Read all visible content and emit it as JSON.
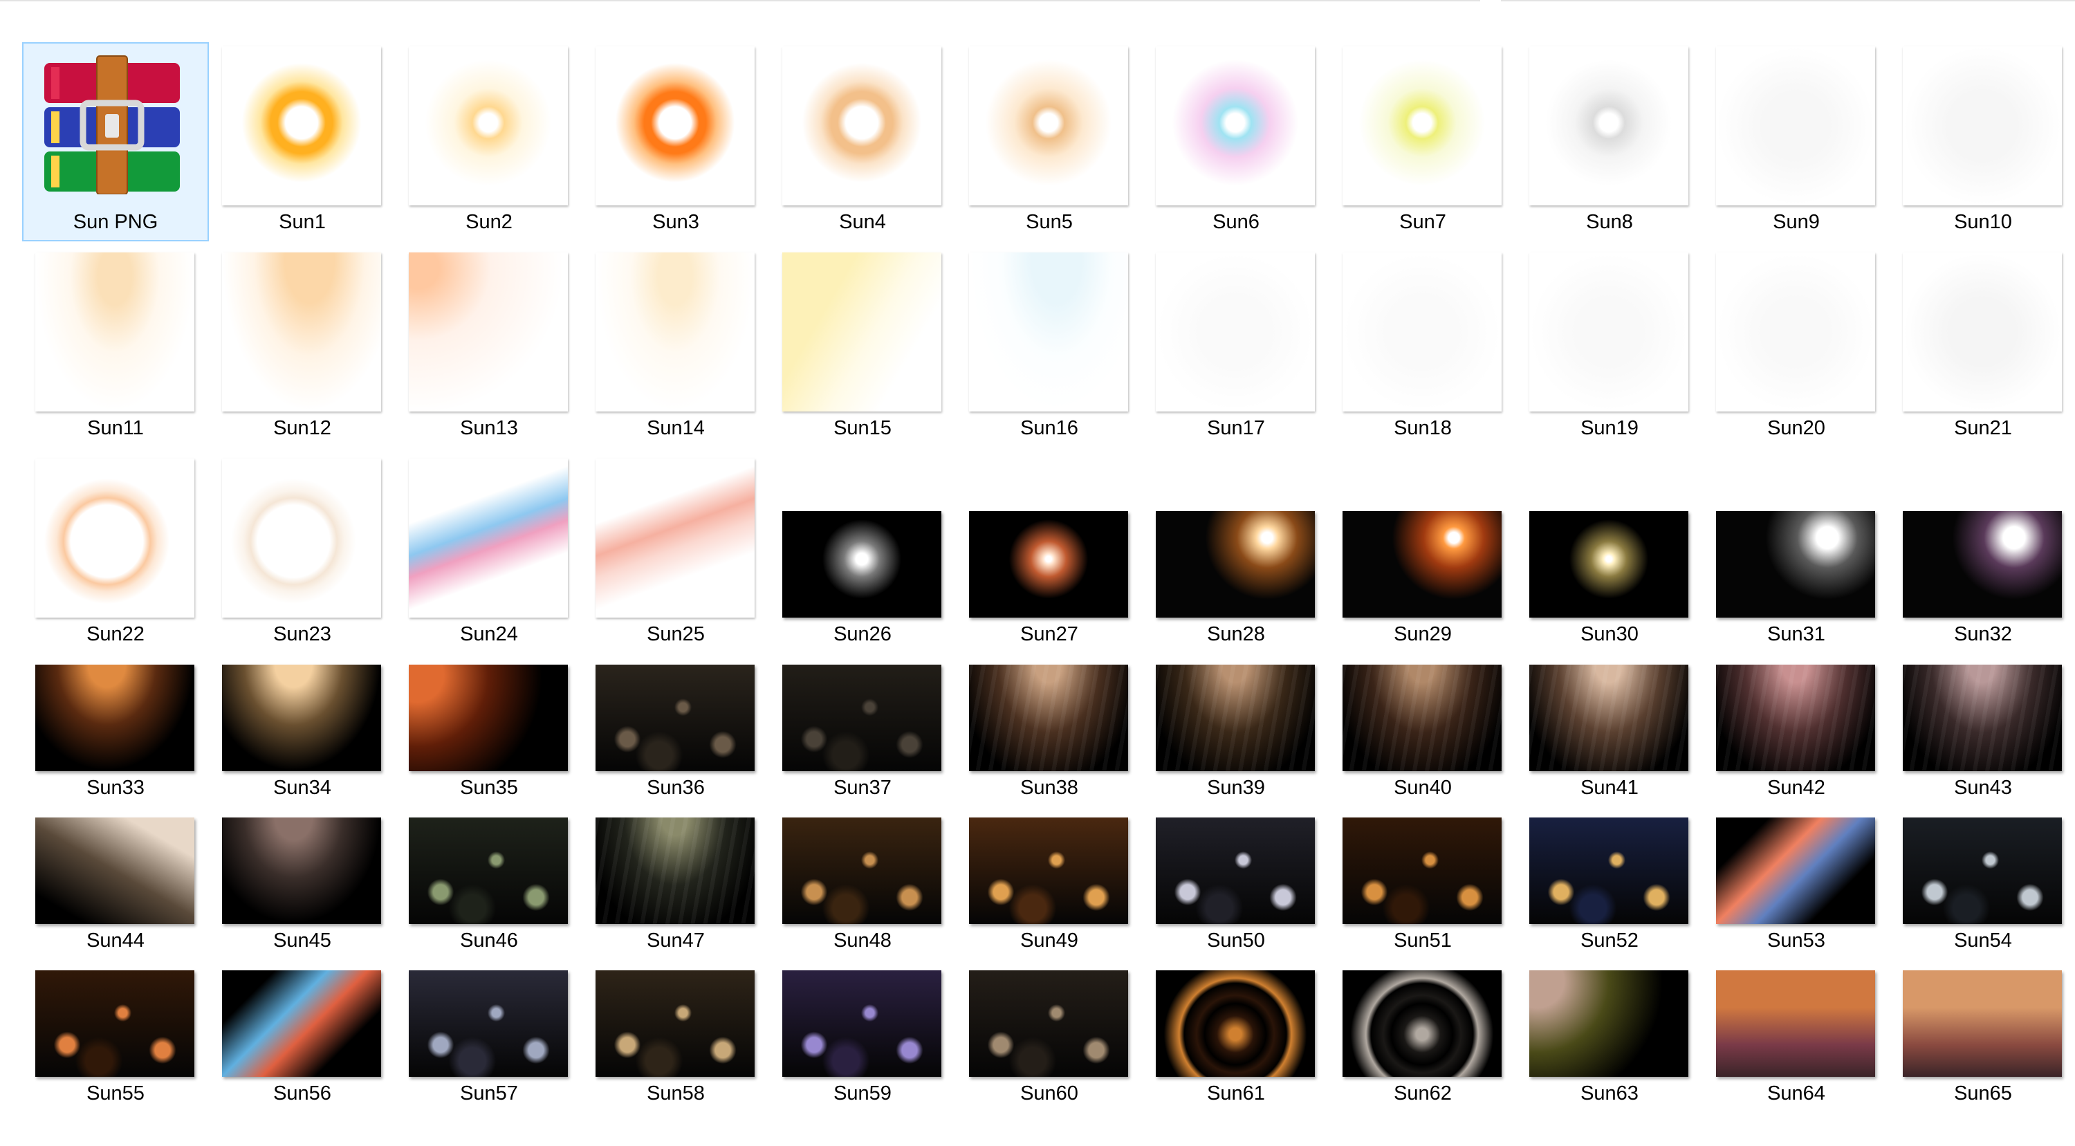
{
  "items": [
    {
      "label": "Sun PNG",
      "type": "archive",
      "selected": true
    },
    {
      "label": "Sun1",
      "type": "light",
      "look": "ring",
      "c1": "#ffb020",
      "c2": "#ffe6a0"
    },
    {
      "label": "Sun2",
      "type": "light",
      "look": "star",
      "c1": "#ffd890",
      "c2": "#fff6e0"
    },
    {
      "label": "Sun3",
      "type": "light",
      "look": "ring",
      "c1": "#ff7a18",
      "c2": "#ffc080"
    },
    {
      "label": "Sun4",
      "type": "light",
      "look": "ring",
      "c1": "#f3c08a",
      "c2": "#fbe3c8"
    },
    {
      "label": "Sun5",
      "type": "light",
      "look": "star",
      "c1": "#f0c08a",
      "c2": "#fde9d0"
    },
    {
      "label": "Sun6",
      "type": "light",
      "look": "star",
      "c1": "#9fe3f2",
      "c2": "#f6d0f0"
    },
    {
      "label": "Sun7",
      "type": "light",
      "look": "star",
      "c1": "#eef07a",
      "c2": "#f8fad8"
    },
    {
      "label": "Sun8",
      "type": "light",
      "look": "star",
      "c1": "#dcdcdc",
      "c2": "#f4f4f4"
    },
    {
      "label": "Sun9",
      "type": "light",
      "look": "faint",
      "c1": "#f7f7f7",
      "c2": "#ffffff"
    },
    {
      "label": "Sun10",
      "type": "light",
      "look": "faint",
      "c1": "#f6f6f6",
      "c2": "#ffffff"
    },
    {
      "label": "Sun11",
      "type": "light",
      "look": "rays",
      "c1": "#fbe0b8",
      "c2": "#fff8ee"
    },
    {
      "label": "Sun12",
      "type": "light",
      "look": "topglow",
      "c1": "#fcd7a8",
      "c2": "#fff4e6"
    },
    {
      "label": "Sun13",
      "type": "light",
      "look": "cornerglow",
      "c1": "#ffc8a0",
      "c2": "#fff2ea"
    },
    {
      "label": "Sun14",
      "type": "light",
      "look": "rays",
      "c1": "#fdeccc",
      "c2": "#fffaf2"
    },
    {
      "label": "Sun15",
      "type": "light",
      "look": "beam",
      "c1": "#fdf1b8",
      "c2": "#fffbe8"
    },
    {
      "label": "Sun16",
      "type": "light",
      "look": "topglow",
      "c1": "#e8f6fb",
      "c2": "#fbfeff"
    },
    {
      "label": "Sun17",
      "type": "light",
      "look": "faint",
      "c1": "#fafafa",
      "c2": "#ffffff"
    },
    {
      "label": "Sun18",
      "type": "light",
      "look": "faint",
      "c1": "#fafafa",
      "c2": "#ffffff"
    },
    {
      "label": "Sun19",
      "type": "light",
      "look": "faint",
      "c1": "#f9f9f9",
      "c2": "#ffffff"
    },
    {
      "label": "Sun20",
      "type": "light",
      "look": "faint",
      "c1": "#f9f9f9",
      "c2": "#ffffff"
    },
    {
      "label": "Sun21",
      "type": "light",
      "look": "faint",
      "c1": "#f5f5f5",
      "c2": "#ffffff"
    },
    {
      "label": "Sun22",
      "type": "light",
      "look": "halo",
      "c1": "#fbc9a0",
      "c2": "#fde8d6"
    },
    {
      "label": "Sun23",
      "type": "light",
      "look": "halo",
      "c1": "#f5e6d6",
      "c2": "#fbf4ec"
    },
    {
      "label": "Sun24",
      "type": "light",
      "look": "flare",
      "c1": "#8ec8f0",
      "c2": "#f0a0c0"
    },
    {
      "label": "Sun25",
      "type": "light",
      "look": "flare",
      "c1": "#f6b0a0",
      "c2": "#fbd8d0"
    },
    {
      "label": "Sun26",
      "type": "dark",
      "look": "star",
      "c1": "#ffffff",
      "c2": "#7a7a7a"
    },
    {
      "label": "Sun27",
      "type": "dark",
      "look": "star",
      "c1": "#ffe0c8",
      "c2": "#c05a30"
    },
    {
      "label": "Sun28",
      "type": "dark",
      "look": "spot",
      "c1": "#ffd8a0",
      "c2": "#8a4a18"
    },
    {
      "label": "Sun29",
      "type": "dark",
      "look": "spot",
      "c1": "#ff9a40",
      "c2": "#a03a10"
    },
    {
      "label": "Sun30",
      "type": "dark",
      "look": "star",
      "c1": "#fff0c0",
      "c2": "#8a7a40"
    },
    {
      "label": "Sun31",
      "type": "dark",
      "look": "spot",
      "c1": "#ffffff",
      "c2": "#5a5a5a"
    },
    {
      "label": "Sun32",
      "type": "dark",
      "look": "spot",
      "c1": "#ffffff",
      "c2": "#5a3a5a"
    },
    {
      "label": "Sun33",
      "type": "dark",
      "look": "topglow",
      "c1": "#e08a40",
      "c2": "#5a2a10"
    },
    {
      "label": "Sun34",
      "type": "dark",
      "look": "topglow",
      "c1": "#f4d0a0",
      "c2": "#6a5030"
    },
    {
      "label": "Sun35",
      "type": "dark",
      "look": "cornerglow",
      "c1": "#e06a30",
      "c2": "#601e08"
    },
    {
      "label": "Sun36",
      "type": "dark",
      "look": "bokeh",
      "c1": "#6a5a48",
      "c2": "#2a241c"
    },
    {
      "label": "Sun37",
      "type": "dark",
      "look": "bokeh",
      "c1": "#4a4238",
      "c2": "#221e18"
    },
    {
      "label": "Sun38",
      "type": "dark",
      "look": "rays",
      "c1": "#c8a080",
      "c2": "#4a3020"
    },
    {
      "label": "Sun39",
      "type": "dark",
      "look": "rays",
      "c1": "#b89070",
      "c2": "#3a2818"
    },
    {
      "label": "Sun40",
      "type": "dark",
      "look": "rays",
      "c1": "#b08868",
      "c2": "#3a2418"
    },
    {
      "label": "Sun41",
      "type": "dark",
      "look": "rays",
      "c1": "#d8b8a0",
      "c2": "#5a4030"
    },
    {
      "label": "Sun42",
      "type": "dark",
      "look": "rays",
      "c1": "#c89090",
      "c2": "#503030"
    },
    {
      "label": "Sun43",
      "type": "dark",
      "look": "rays",
      "c1": "#b89898",
      "c2": "#3a2a2a"
    },
    {
      "label": "Sun44",
      "type": "dark",
      "look": "beam",
      "c1": "#e8d8c8",
      "c2": "#5a4a3a"
    },
    {
      "label": "Sun45",
      "type": "dark",
      "look": "topglow",
      "c1": "#8a7068",
      "c2": "#3a2e2a"
    },
    {
      "label": "Sun46",
      "type": "dark",
      "look": "bokeh",
      "c1": "#8a9a70",
      "c2": "#1e221a"
    },
    {
      "label": "Sun47",
      "type": "dark",
      "look": "rays",
      "c1": "#8a8a6a",
      "c2": "#22241c"
    },
    {
      "label": "Sun48",
      "type": "dark",
      "look": "bokeh",
      "c1": "#c89050",
      "c2": "#3a2410"
    },
    {
      "label": "Sun49",
      "type": "dark",
      "look": "bokeh",
      "c1": "#e0a050",
      "c2": "#4a2810"
    },
    {
      "label": "Sun50",
      "type": "dark",
      "look": "bokeh",
      "c1": "#c8c8d8",
      "c2": "#202028"
    },
    {
      "label": "Sun51",
      "type": "dark",
      "look": "bokeh",
      "c1": "#d89040",
      "c2": "#301808"
    },
    {
      "label": "Sun52",
      "type": "dark",
      "look": "bokeh",
      "c1": "#e0b060",
      "c2": "#182040"
    },
    {
      "label": "Sun53",
      "type": "dark",
      "look": "flare",
      "c1": "#f08060",
      "c2": "#6080c0"
    },
    {
      "label": "Sun54",
      "type": "dark",
      "look": "bokeh",
      "c1": "#c0c8d0",
      "c2": "#1a1e24"
    },
    {
      "label": "Sun55",
      "type": "dark",
      "look": "bokeh",
      "c1": "#e08040",
      "c2": "#301808"
    },
    {
      "label": "Sun56",
      "type": "dark",
      "look": "flare",
      "c1": "#60b0e0",
      "c2": "#e06040"
    },
    {
      "label": "Sun57",
      "type": "dark",
      "look": "bokeh",
      "c1": "#a0a8c0",
      "c2": "#2a2a38"
    },
    {
      "label": "Sun58",
      "type": "dark",
      "look": "bokeh",
      "c1": "#c8a878",
      "c2": "#2e2418"
    },
    {
      "label": "Sun59",
      "type": "dark",
      "look": "bokeh",
      "c1": "#9888d0",
      "c2": "#2a2040"
    },
    {
      "label": "Sun60",
      "type": "dark",
      "look": "bokeh",
      "c1": "#a08a70",
      "c2": "#241e18"
    },
    {
      "label": "Sun61",
      "type": "dark",
      "look": "swirl",
      "c1": "#d08030",
      "c2": "#2a1408"
    },
    {
      "label": "Sun62",
      "type": "dark",
      "look": "swirl",
      "c1": "#b0a8a0",
      "c2": "#1a1816"
    },
    {
      "label": "Sun63",
      "type": "dark",
      "look": "cornerglow",
      "c1": "#c0a090",
      "c2": "#4a4a18"
    },
    {
      "label": "Sun64",
      "type": "dark",
      "look": "gradient",
      "c1": "#d07840",
      "c2": "#7a3a48"
    },
    {
      "label": "Sun65",
      "type": "dark",
      "look": "gradient",
      "c1": "#d89868",
      "c2": "#8a4a40"
    }
  ]
}
